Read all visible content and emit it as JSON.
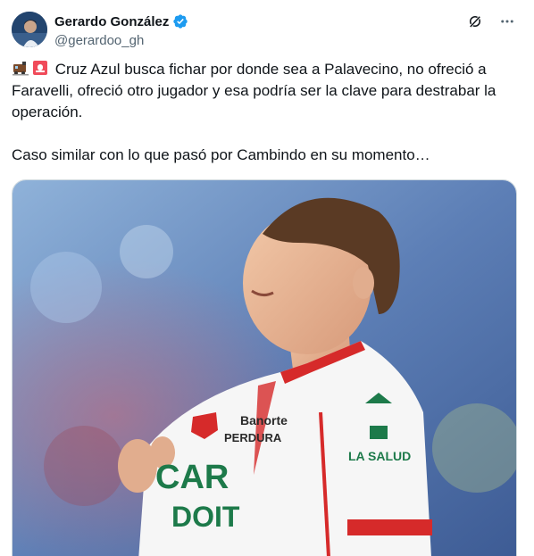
{
  "author": {
    "name": "Gerardo González",
    "handle": "@gerardoo_gh",
    "verified": true,
    "avatar": "avatar-photo"
  },
  "actions": {
    "grok_icon": "grok-icon",
    "more_icon": "more-icon"
  },
  "tweet": {
    "emojis": [
      "train-emoji",
      "siren-emoji"
    ],
    "line1": "Cruz Azul busca fichar por donde sea a Palavecino, no ofreció a Faravelli, ofreció otro jugador y esa podría ser la clave para destrabar la operación.",
    "line2": "Caso similar con lo que pasó por Cambindo en su momento…"
  },
  "media": {
    "kind": "photo",
    "description_icon": "player-photo",
    "jersey_texts": [
      "Banorte",
      "PERDURA",
      "CAR",
      "DOIT",
      "LA SALUD"
    ]
  },
  "colors": {
    "accent": "#1d9bf0",
    "text": "#0f1419",
    "muted": "#536471"
  }
}
